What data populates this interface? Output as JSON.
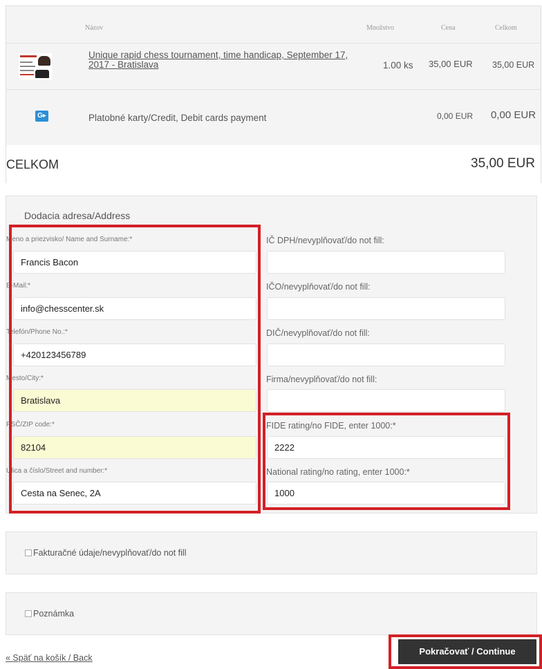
{
  "cart": {
    "headers": {
      "name": "Názov",
      "qty": "Množstvo",
      "price": "Cena",
      "total": "Celkom"
    },
    "product": {
      "image_icon": "chess-tournament-thumbnail",
      "title": "Unique rapid chess tournament, time handicap, September 17, 2017 - Bratislava",
      "qty": "1.00 ks",
      "price": "35,00 EUR",
      "total": "35,00 EUR"
    },
    "payment": {
      "icon": "gopay-icon",
      "icon_text": "G▸",
      "label": "Platobné karty/Credit, Debit cards payment",
      "price": "0,00 EUR",
      "total": "0,00 EUR"
    },
    "grand": {
      "label": "CELKOM",
      "value": "35,00 EUR"
    }
  },
  "address": {
    "title": "Dodacia adresa/Address",
    "left": [
      {
        "label": "Meno a priezvisko/ Name and Surname:*",
        "value": "Francis Bacon"
      },
      {
        "label": "E-Mail:*",
        "value": "info@chesscenter.sk"
      },
      {
        "label": "Telefón/Phone No.:*",
        "value": "+420123456789"
      },
      {
        "label": "Mesto/City:*",
        "value": "Bratislava"
      },
      {
        "label": "PSČ/ZIP code:*",
        "value": "82104"
      },
      {
        "label": "Ulica a číslo/Street and number:*",
        "value": "Cesta na Senec, 2A"
      }
    ],
    "right": [
      {
        "label": "IČ DPH/nevyplňovať/do not fill:",
        "value": ""
      },
      {
        "label": "IČO/nevyplňovať/do not fill:",
        "value": ""
      },
      {
        "label": "DIČ/nevyplňovať/do not fill:",
        "value": ""
      },
      {
        "label": "Firma/nevyplňovať/do not fill:",
        "value": ""
      },
      {
        "label": "FIDE rating/no FIDE, enter 1000:*",
        "value": "2222"
      },
      {
        "label": "National rating/no rating, enter 1000:*",
        "value": "1000"
      }
    ]
  },
  "options": {
    "invoice_label": "Fakturačné údaje/nevyplňovať/do not fill",
    "note_label": "Poznámka"
  },
  "footer": {
    "back_label": "« Späť na košík / Back",
    "continue_label": "Pokračovať / Continue"
  },
  "colors": {
    "highlight": "#d32027",
    "autofill": "#fbfbd3",
    "button": "#333333"
  }
}
